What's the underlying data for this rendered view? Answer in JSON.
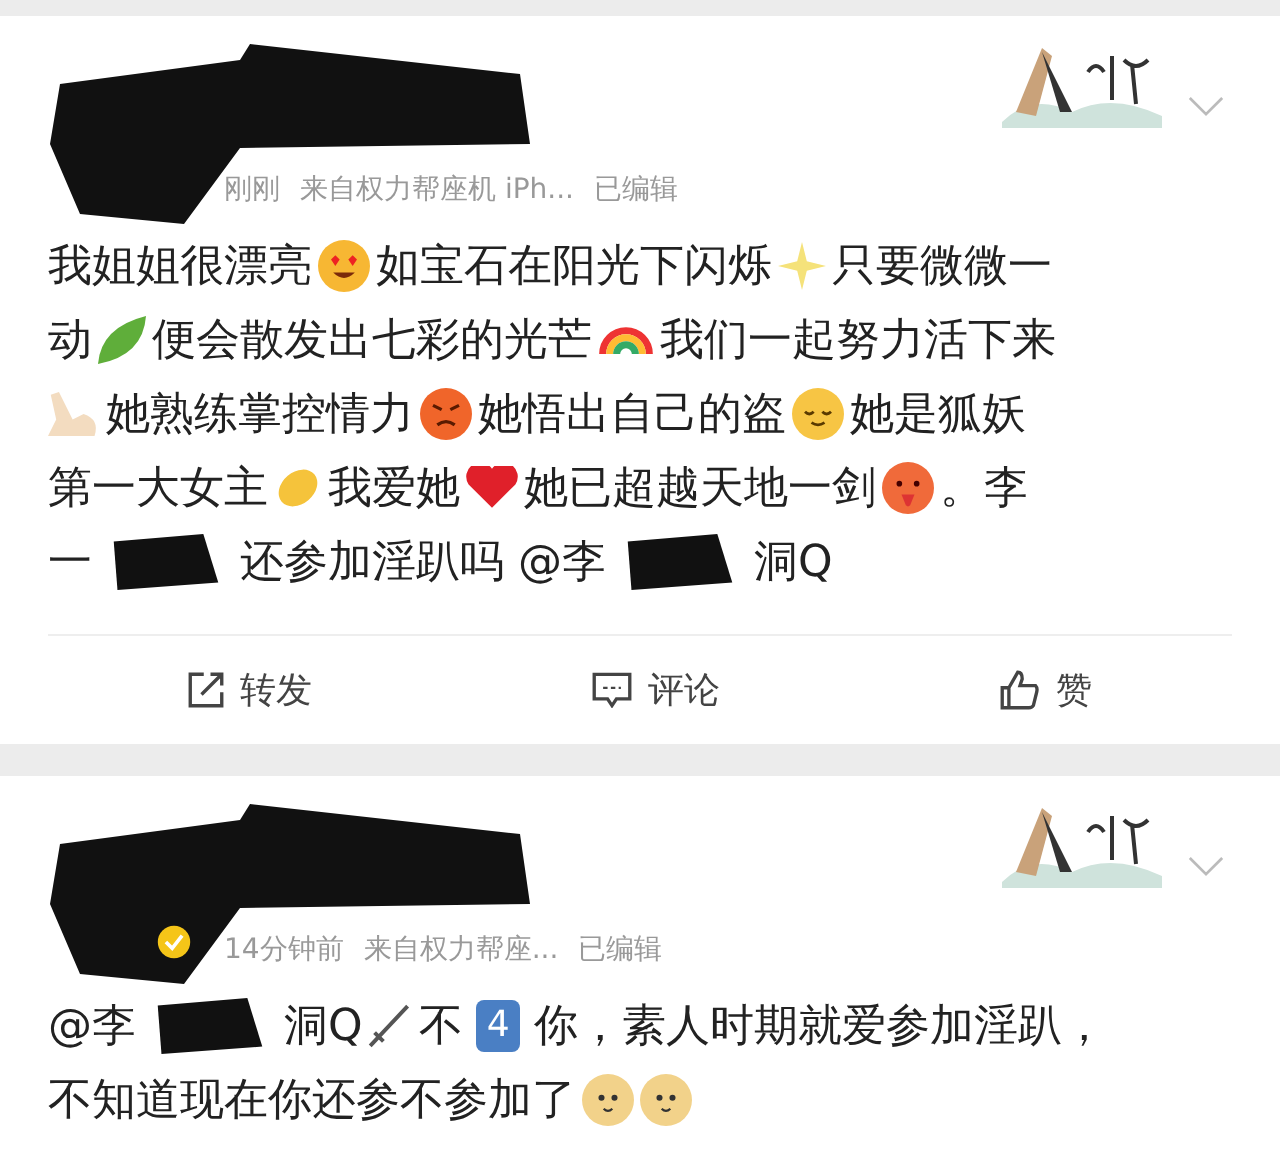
{
  "posts": [
    {
      "time": "刚刚",
      "source": "来自权力帮座机 iPh...",
      "edited": "已编辑",
      "verified": false,
      "lines": [
        [
          {
            "kind": "text",
            "text": "我姐姐很漂亮"
          },
          {
            "kind": "heart-eyes"
          },
          {
            "kind": "text",
            "text": "如宝石在阳光下闪烁"
          },
          {
            "kind": "sparkles"
          },
          {
            "kind": "text",
            "text": "只要微微一"
          }
        ],
        [
          {
            "kind": "text",
            "text": "动"
          },
          {
            "kind": "leaf"
          },
          {
            "kind": "text",
            "text": "便会散发出七彩的光芒"
          },
          {
            "kind": "rainbow"
          },
          {
            "kind": "text",
            "text": "我们一起努力活下来"
          }
        ],
        [
          {
            "kind": "arm"
          },
          {
            "kind": "text",
            "text": "她熟练掌控情力"
          },
          {
            "kind": "angry"
          },
          {
            "kind": "text",
            "text": "她悟出自己的盗"
          },
          {
            "kind": "relieved"
          },
          {
            "kind": "text",
            "text": "她是狐妖"
          }
        ],
        [
          {
            "kind": "text",
            "text": "第一大女主"
          },
          {
            "kind": "clap"
          },
          {
            "kind": "text",
            "text": "我爱她"
          },
          {
            "kind": "heart"
          },
          {
            "kind": "text",
            "text": "她已超越天地一剑"
          },
          {
            "kind": "hot-face"
          },
          {
            "kind": "text",
            "text": "。李"
          }
        ],
        [
          {
            "kind": "text",
            "text": "一"
          },
          {
            "kind": "redaction"
          },
          {
            "kind": "text",
            "text": "还参加淫趴吗 @李"
          },
          {
            "kind": "redaction"
          },
          {
            "kind": "text",
            "text": "洞Q"
          }
        ]
      ],
      "actions": [
        {
          "kind": "share",
          "label": "转发"
        },
        {
          "kind": "comment",
          "label": "评论"
        },
        {
          "kind": "like",
          "label": "赞"
        }
      ]
    },
    {
      "time": "14分钟前",
      "source": "来自权力帮座...",
      "edited": "已编辑",
      "verified": true,
      "lines": [
        [
          {
            "kind": "text",
            "text": "@李"
          },
          {
            "kind": "redaction"
          },
          {
            "kind": "text",
            "text": "洞Q"
          },
          {
            "kind": "sword"
          },
          {
            "kind": "text",
            "text": "不"
          },
          {
            "kind": "keycap",
            "text": "4"
          },
          {
            "kind": "text",
            "text": "你，素人时期就爱参加淫趴，"
          }
        ],
        [
          {
            "kind": "text",
            "text": "不知道现在你还参不参加了"
          },
          {
            "kind": "doge"
          },
          {
            "kind": "doge"
          }
        ]
      ]
    }
  ]
}
